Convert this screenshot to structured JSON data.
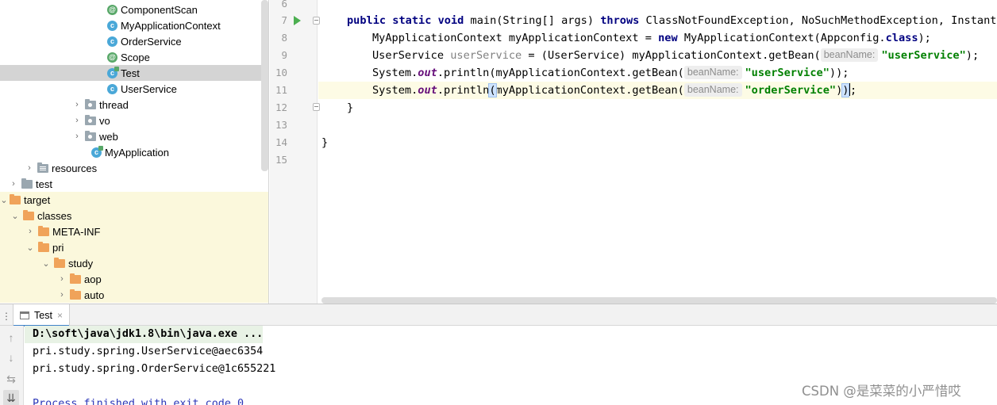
{
  "tree": {
    "items": [
      {
        "label": "ComponentScan",
        "icon": "annotation-icon",
        "arrow": ""
      },
      {
        "label": "MyApplicationContext",
        "icon": "class-icon",
        "arrow": ""
      },
      {
        "label": "OrderService",
        "icon": "class-icon",
        "arrow": ""
      },
      {
        "label": "Scope",
        "icon": "annotation-icon",
        "arrow": ""
      },
      {
        "label": "Test",
        "icon": "main-class-icon",
        "arrow": ""
      },
      {
        "label": "UserService",
        "icon": "class-icon",
        "arrow": ""
      },
      {
        "label": "thread",
        "icon": "package-icon",
        "arrow": "›"
      },
      {
        "label": "vo",
        "icon": "package-icon",
        "arrow": "›"
      },
      {
        "label": "web",
        "icon": "package-icon",
        "arrow": "›"
      },
      {
        "label": "MyApplication",
        "icon": "main-class-icon",
        "arrow": ""
      },
      {
        "label": "resources",
        "icon": "resources-folder-icon",
        "arrow": "›"
      },
      {
        "label": "test",
        "icon": "folder-icon",
        "arrow": "›"
      },
      {
        "label": "target",
        "icon": "folder-orange-icon",
        "arrow": "⌄"
      },
      {
        "label": "classes",
        "icon": "folder-orange-icon",
        "arrow": "⌄"
      },
      {
        "label": "META-INF",
        "icon": "folder-orange-icon",
        "arrow": "›"
      },
      {
        "label": "pri",
        "icon": "folder-orange-icon",
        "arrow": "⌄"
      },
      {
        "label": "study",
        "icon": "folder-orange-icon",
        "arrow": "⌄"
      },
      {
        "label": "aop",
        "icon": "folder-orange-icon",
        "arrow": "›"
      },
      {
        "label": "auto",
        "icon": "folder-orange-icon",
        "arrow": "›"
      }
    ]
  },
  "editor": {
    "line_numbers": [
      "6",
      "7",
      "8",
      "9",
      "10",
      "11",
      "12",
      "13",
      "14",
      "15"
    ],
    "tokens": {
      "public_static_void": "public static void",
      "main_sig": " main(String[] args) ",
      "throws": "throws",
      "throws_list": " ClassNotFoundException, NoSuchMethodException, Instantiat",
      "l8_a": "MyApplicationContext myApplicationContext = ",
      "new": "new",
      "l8_b": " MyApplicationContext(Appconfig.",
      "class": "class",
      "l8_c": ");",
      "l9_a": "UserService ",
      "l9_var": "userService",
      "l9_b": " = (UserService) myApplicationContext.getBean(",
      "hint": "beanName:",
      "str_user": "\"userService\"",
      "l9_c": ");",
      "system": "System.",
      "out": "out",
      "println_a": ".println",
      "paren_open": "(",
      "getbean_a": "myApplicationContext.getBean(",
      "l10_c": "));",
      "str_order": "\"orderService\"",
      "l11_c1": ")",
      "paren_close": ")",
      "l11_c2": ";",
      "brace_inner": "}",
      "brace_outer": "}"
    }
  },
  "run": {
    "tab_label": "Test",
    "tab_close": "×",
    "toolbar": {
      "up": "↑",
      "down": "↓",
      "wrap": "⇆",
      "scroll_end": "⇊"
    },
    "output": {
      "cmd": "D:\\soft\\java\\jdk1.8\\bin\\java.exe ...",
      "line1": "pri.study.spring.UserService@aec6354",
      "line2": "pri.study.spring.OrderService@1c655221",
      "exit": "Process finished with exit code 0"
    }
  },
  "watermark": "CSDN @是菜菜的小严惜哎"
}
